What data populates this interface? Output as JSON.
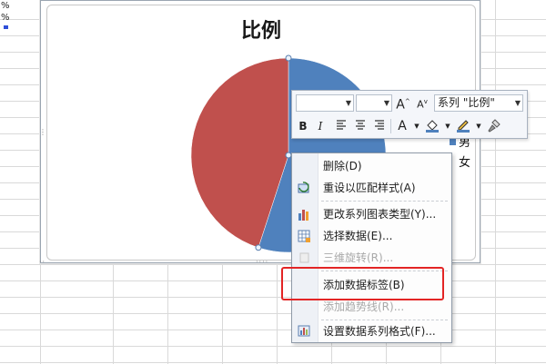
{
  "sheet": {
    "cell_texts": [
      "%",
      "%"
    ]
  },
  "chart": {
    "title": "比例",
    "legend": [
      {
        "label": "男",
        "color": "#4f81bd"
      },
      {
        "label": "女",
        "color": "#c0504d"
      }
    ]
  },
  "chart_data": {
    "type": "pie",
    "title": "比例",
    "categories": [
      "男",
      "女"
    ],
    "values": [
      0.55,
      0.45
    ],
    "colors": [
      "#4f81bd",
      "#c0504d"
    ],
    "legend_position": "right"
  },
  "mini_toolbar": {
    "font_name": "",
    "font_size": "",
    "grow_font": "A",
    "shrink_font": "A",
    "series_select": "系列 \"比例\"",
    "bold": "B",
    "italic": "I",
    "font_color": "A"
  },
  "context_menu": {
    "items": [
      {
        "label": "删除(D)",
        "icon": "none",
        "disabled": false
      },
      {
        "label": "重设以匹配样式(A)",
        "icon": "reset-style-icon",
        "disabled": false
      },
      {
        "label": "更改系列图表类型(Y)...",
        "icon": "bar-chart-icon",
        "disabled": false
      },
      {
        "label": "选择数据(E)...",
        "icon": "select-data-icon",
        "disabled": false
      },
      {
        "label": "三维旋转(R)...",
        "icon": "rotate-3d-icon",
        "disabled": true
      },
      {
        "label": "添加数据标签(B)",
        "icon": "none",
        "disabled": false
      },
      {
        "label": "添加趋势线(R)...",
        "icon": "none",
        "disabled": true
      },
      {
        "label": "设置数据系列格式(F)...",
        "icon": "format-series-icon",
        "disabled": false
      }
    ]
  },
  "colors": {
    "highlight": "#e32525",
    "series_male": "#4f81bd",
    "series_female": "#c0504d"
  }
}
